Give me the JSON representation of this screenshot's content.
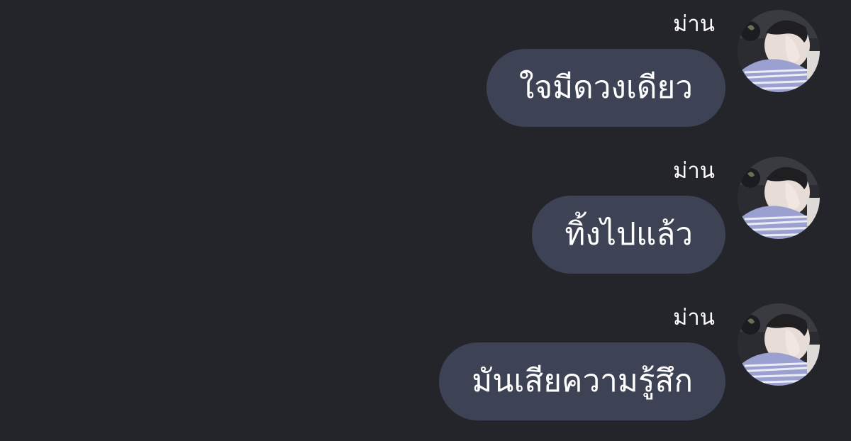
{
  "conversation": {
    "messages": [
      {
        "sender": "ม่าน",
        "text": "ใจมีดวงเดียว",
        "avatar_icon": "user-avatar-photo"
      },
      {
        "sender": "ม่าน",
        "text": "ทิ้งไปแล้ว",
        "avatar_icon": "user-avatar-photo"
      },
      {
        "sender": "ม่าน",
        "text": "มันเสียความรู้สึก",
        "avatar_icon": "user-avatar-photo"
      }
    ]
  },
  "colors": {
    "background": "#24242b",
    "bubble": "#3d4354",
    "text": "#ffffff"
  }
}
